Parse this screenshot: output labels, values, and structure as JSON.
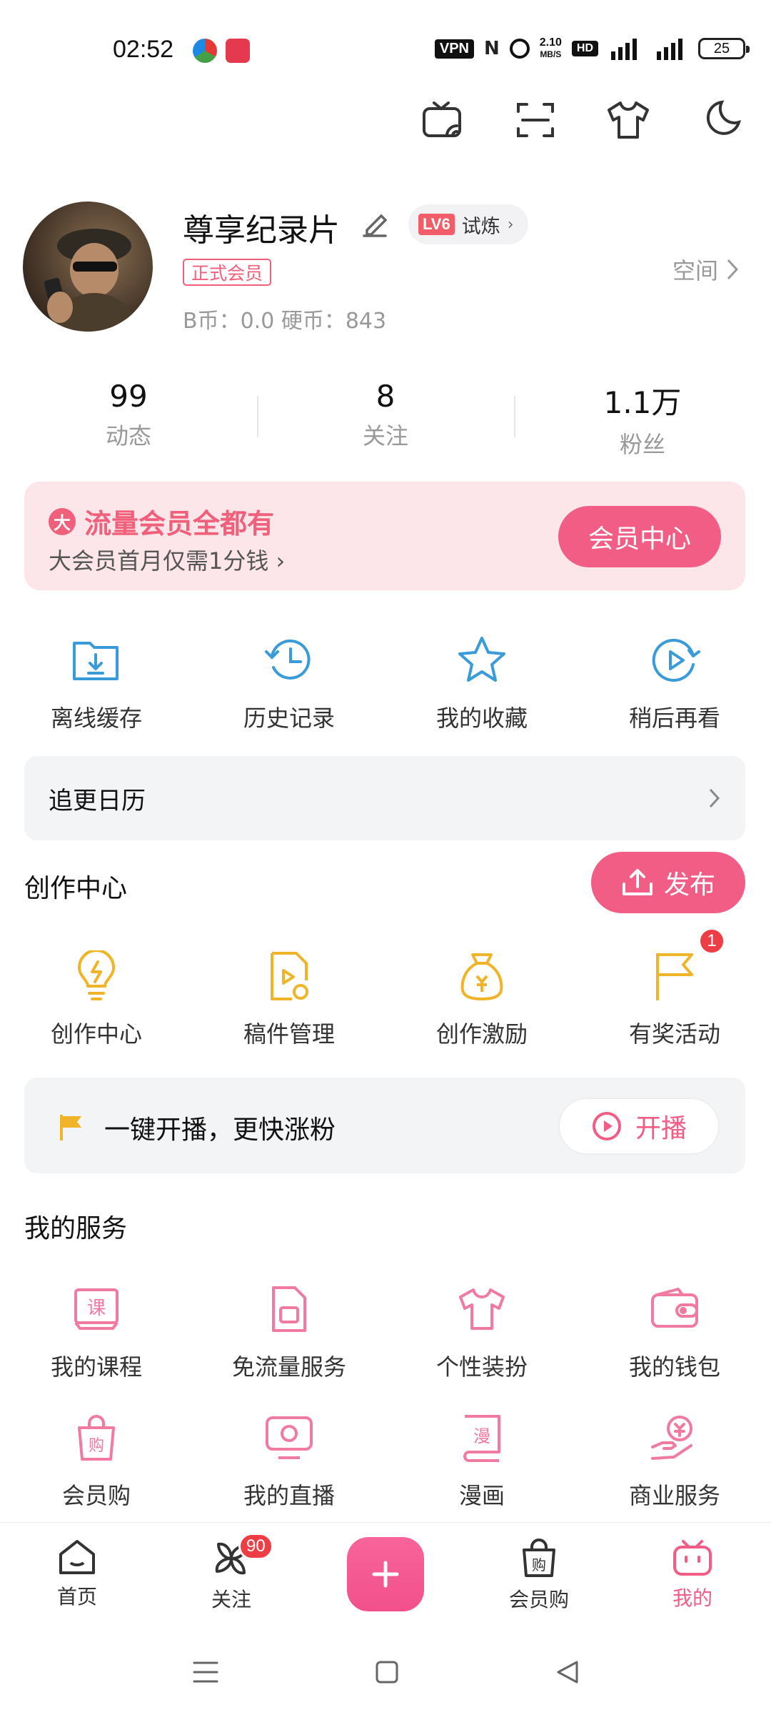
{
  "status_bar": {
    "time": "02:52",
    "vpn": "VPN",
    "net_speed_value": "2.10",
    "net_speed_unit": "MB/S",
    "hd": "HD",
    "battery": "25"
  },
  "top_icons": [
    "tv-cast-icon",
    "scan-icon",
    "tshirt-icon",
    "moon-icon"
  ],
  "profile": {
    "username": "尊享纪录片",
    "level": "LV6",
    "level_label": "试炼",
    "member_tag": "正式会员",
    "coins": "B币：0.0    硬币：843",
    "space_label": "空间"
  },
  "stats": [
    {
      "value": "99",
      "label": "动态"
    },
    {
      "value": "8",
      "label": "关注"
    },
    {
      "value": "1.1万",
      "label": "粉丝"
    }
  ],
  "vip_banner": {
    "icon_text": "大",
    "title": "流量会员全都有",
    "subtitle": "大会员首月仅需1分钱",
    "button": "会员中心"
  },
  "quick_actions": [
    {
      "label": "离线缓存",
      "icon": "offline-cache-icon"
    },
    {
      "label": "历史记录",
      "icon": "history-icon"
    },
    {
      "label": "我的收藏",
      "icon": "favorites-icon"
    },
    {
      "label": "稍后再看",
      "icon": "watch-later-icon"
    }
  ],
  "calendar": {
    "label": "追更日历"
  },
  "creation": {
    "title": "创作中心",
    "publish": "发布",
    "items": [
      {
        "label": "创作中心",
        "icon": "lightbulb-icon"
      },
      {
        "label": "稿件管理",
        "icon": "manuscript-icon"
      },
      {
        "label": "创作激励",
        "icon": "money-bag-icon"
      },
      {
        "label": "有奖活动",
        "icon": "flag-icon",
        "badge": "1"
      }
    ]
  },
  "live": {
    "text": "一键开播，更快涨粉",
    "button": "开播"
  },
  "services": {
    "title": "我的服务",
    "row1": [
      {
        "label": "我的课程",
        "icon": "course-icon"
      },
      {
        "label": "免流量服务",
        "icon": "sim-card-icon"
      },
      {
        "label": "个性装扮",
        "icon": "tshirt-icon"
      },
      {
        "label": "我的钱包",
        "icon": "wallet-icon"
      }
    ],
    "row2": [
      {
        "label": "会员购",
        "icon": "shopping-bag-icon"
      },
      {
        "label": "我的直播",
        "icon": "live-tv-icon"
      },
      {
        "label": "漫画",
        "icon": "comic-icon"
      },
      {
        "label": "商业服务",
        "icon": "business-icon"
      }
    ]
  },
  "tabbar": {
    "home": "首页",
    "follow": "关注",
    "follow_badge": "90",
    "shop": "会员购",
    "mine": "我的"
  },
  "colors": {
    "accent": "#f25d86",
    "blue_icon": "#3a9bd9",
    "yellow_icon": "#f0b429"
  }
}
